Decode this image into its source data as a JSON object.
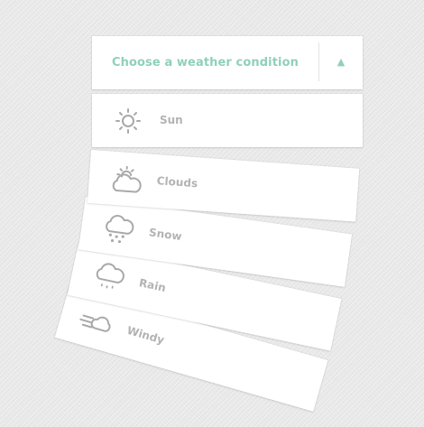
{
  "dropdown": {
    "placeholder": "Choose a weather condition",
    "toggle_glyph": "▲",
    "accent_color": "#8fd0bb",
    "options": [
      {
        "label": "Sun",
        "icon": "sun-icon"
      },
      {
        "label": "Clouds",
        "icon": "clouds-icon"
      },
      {
        "label": "Snow",
        "icon": "snow-icon"
      },
      {
        "label": "Rain",
        "icon": "rain-icon"
      },
      {
        "label": "Windy",
        "icon": "windy-icon"
      }
    ]
  }
}
